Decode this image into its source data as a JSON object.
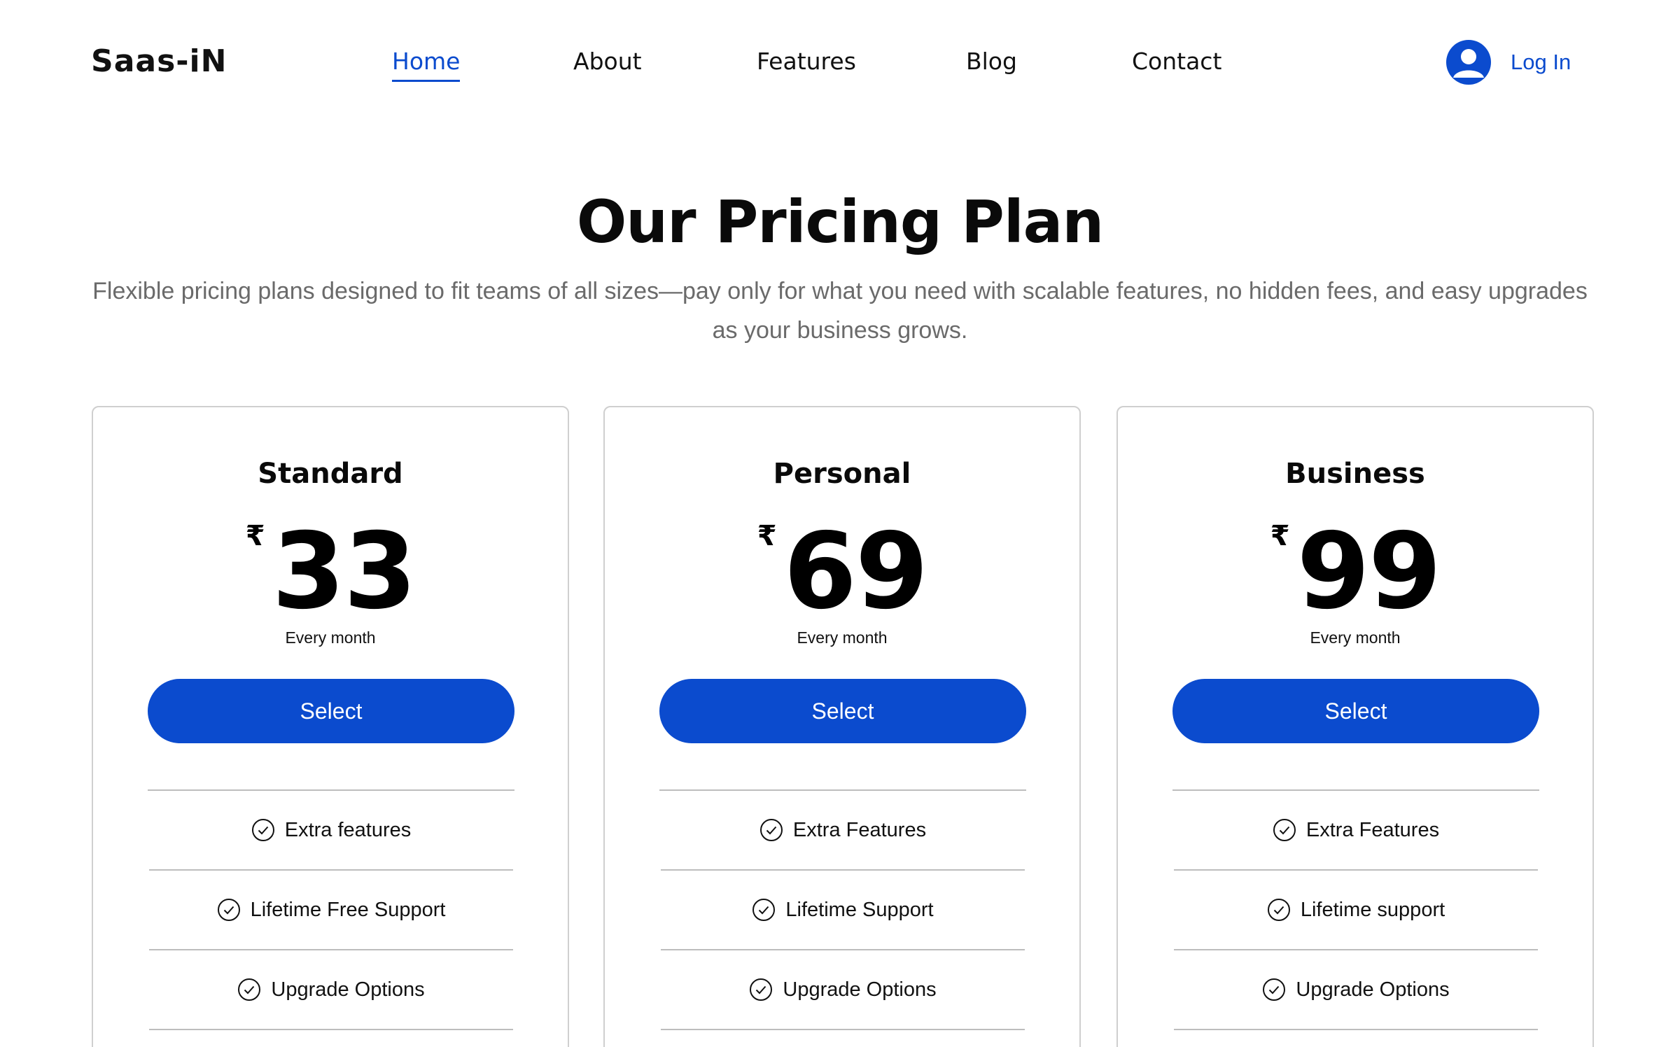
{
  "header": {
    "logo": "Saas-iN",
    "nav": [
      {
        "label": "Home",
        "active": true
      },
      {
        "label": "About",
        "active": false
      },
      {
        "label": "Features",
        "active": false
      },
      {
        "label": "Blog",
        "active": false
      },
      {
        "label": "Contact",
        "active": false
      }
    ],
    "login_label": "Log In",
    "login_icon": "user-avatar-icon"
  },
  "hero": {
    "title": "Our Pricing Plan",
    "subtitle": "Flexible pricing plans designed to fit teams of all sizes—pay only for what you need with scalable features, no hidden fees, and easy upgrades as your business grows."
  },
  "plans": [
    {
      "name": "Standard",
      "currency": "₹",
      "price": "33",
      "period": "Every month",
      "button": "Select",
      "features": [
        "Extra features",
        "Lifetime Free Support",
        "Upgrade Options"
      ]
    },
    {
      "name": "Personal",
      "currency": "₹",
      "price": "69",
      "period": "Every month",
      "button": "Select",
      "features": [
        "Extra Features",
        "Lifetime Support",
        "Upgrade Options"
      ]
    },
    {
      "name": "Business",
      "currency": "₹",
      "price": "99",
      "period": "Every month",
      "button": "Select",
      "features": [
        "Extra Features",
        "Lifetime support",
        "Upgrade Options"
      ]
    }
  ],
  "colors": {
    "accent": "#0b4bce",
    "text": "#111111",
    "muted": "#6a6a6a",
    "border": "#cfcfcf"
  }
}
